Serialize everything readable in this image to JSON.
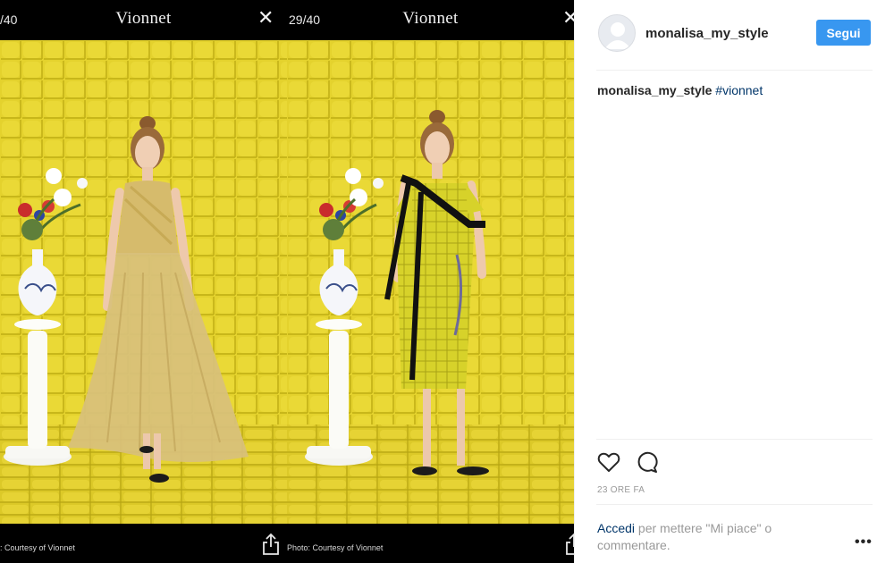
{
  "carousel": {
    "slides": [
      {
        "counter": "/40",
        "brand": "Vionnet",
        "credit": ": Courtesy of Vionnet"
      },
      {
        "counter": "29/40",
        "brand": "Vionnet",
        "credit": "Photo: Courtesy of Vionnet"
      }
    ],
    "close_glyph": "✕",
    "colors": {
      "backdrop": "#e3d12c",
      "floor": "#d9c62a",
      "bars": "#000000"
    }
  },
  "post": {
    "username": "monalisa_my_style",
    "follow_label": "Segui",
    "caption": {
      "user": "monalisa_my_style",
      "hashtag": "#vionnet"
    },
    "time_ago": "23 ORE FA",
    "login": {
      "link": "Accedi",
      "text": " per mettere \"Mi piace\" o commentare."
    },
    "more_glyph": "•••"
  },
  "icons": {
    "like": "heart-icon",
    "comment": "comment-icon",
    "share": "share-icon",
    "close": "close-icon",
    "avatar": "avatar-placeholder-icon"
  },
  "colors": {
    "accent": "#3897f0",
    "link": "#003569",
    "muted": "#999999",
    "text": "#262626"
  }
}
